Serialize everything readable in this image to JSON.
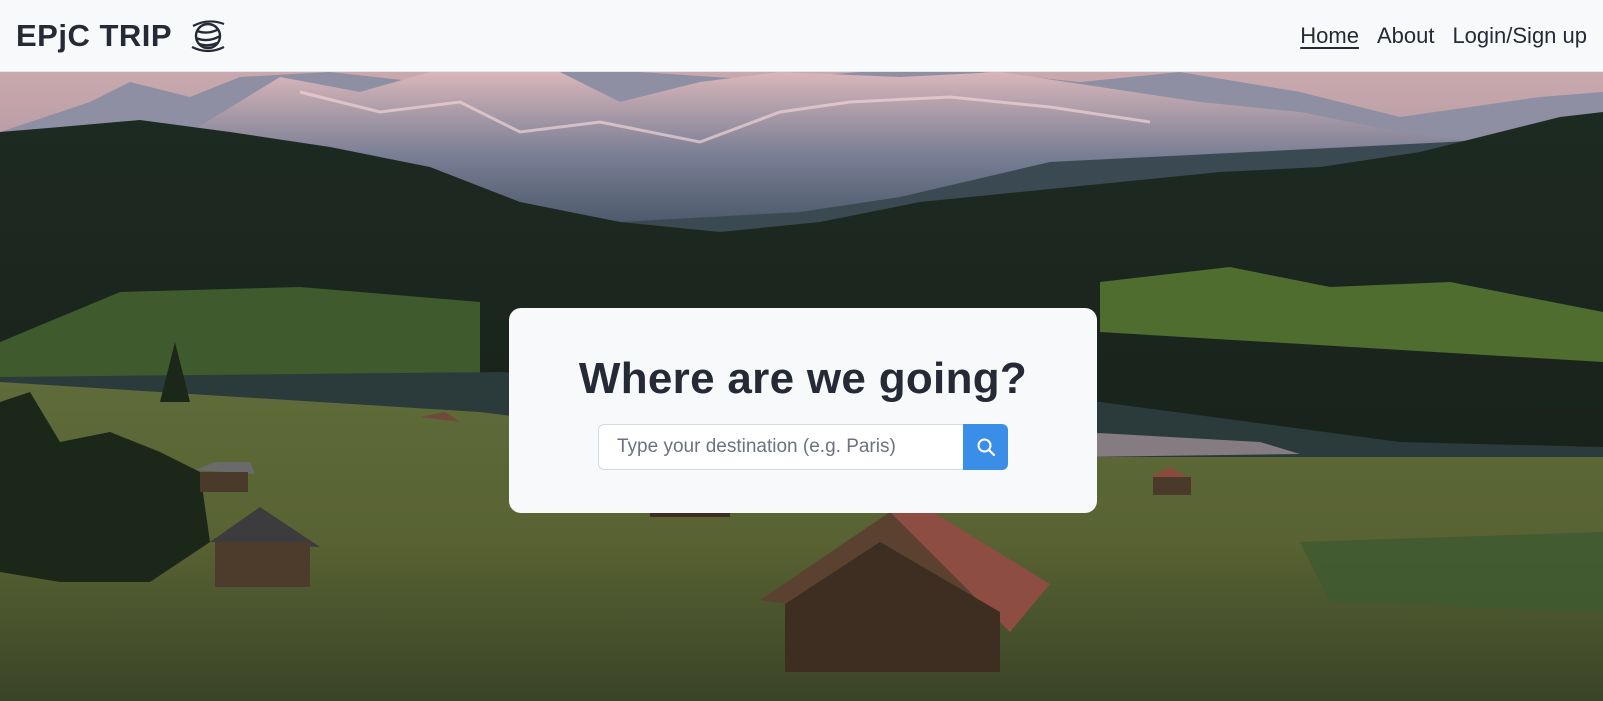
{
  "brand": {
    "name": "EPjC TRIP",
    "icon": "globe-icon"
  },
  "nav": {
    "items": [
      {
        "label": "Home",
        "active": true
      },
      {
        "label": "About",
        "active": false
      },
      {
        "label": "Login/Sign up",
        "active": false
      }
    ]
  },
  "hero": {
    "background": "mountain-lake-meadow-landscape-photo"
  },
  "search_card": {
    "title": "Where are we going?",
    "placeholder": "Type your destination (e.g. Paris)",
    "value": "",
    "button_icon": "search-icon"
  },
  "colors": {
    "navbar_bg": "#f8f9fa",
    "text_dark": "#252a36",
    "accent": "#3b8ee8"
  }
}
